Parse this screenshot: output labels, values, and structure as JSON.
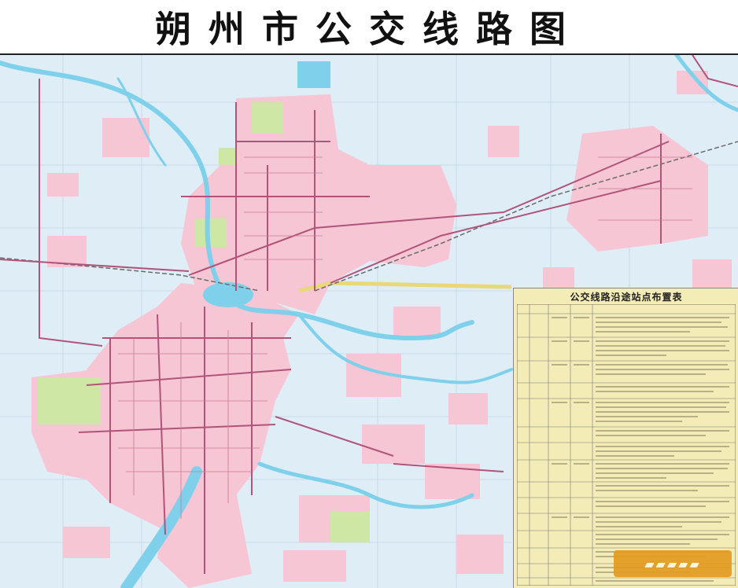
{
  "title": "朔州市公交线路图",
  "legend": {
    "title": "公交线路沿途站点布置表"
  },
  "colors": {
    "background": "#dfeef6",
    "urban": "#f6c6d4",
    "park": "#cfe7a4",
    "water": "#7fd0ea",
    "road": "#b0547a",
    "highway": "#e7d97a",
    "railway": "#6a6a6a",
    "legend_bg": "#f3ecb6",
    "watermark": "#e39b20"
  },
  "icons": [
    "compass-free-map",
    "railway-line",
    "bus-route-line"
  ]
}
